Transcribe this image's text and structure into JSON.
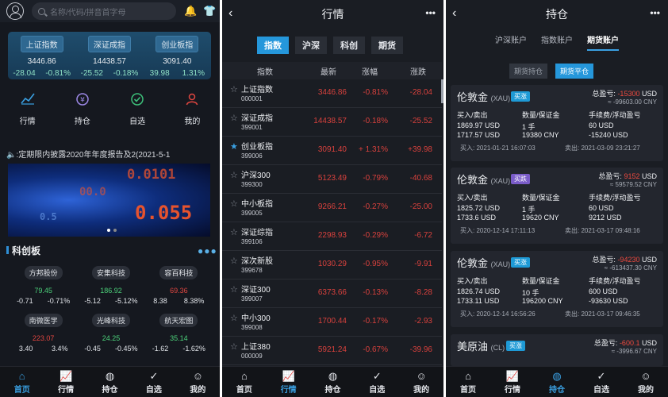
{
  "p1": {
    "search_placeholder": "名称/代码/拼音首字母",
    "indices": [
      {
        "name": "上证指数",
        "value": "3446.86",
        "chg": "-28.04",
        "pct": "-0.81%"
      },
      {
        "name": "深证成指",
        "value": "14438.57",
        "chg": "-25.52",
        "pct": "-0.18%"
      },
      {
        "name": "创业板指",
        "value": "3091.40",
        "chg": "39.98",
        "pct": "1.31%"
      }
    ],
    "grid": [
      {
        "label": "行情",
        "icon": "chart-icon"
      },
      {
        "label": "持仓",
        "icon": "wallet-icon"
      },
      {
        "label": "自选",
        "icon": "check-icon"
      },
      {
        "label": "我的",
        "icon": "user-icon"
      }
    ],
    "marquee": ":定期限内披露2020年年度报告及2(2021-5-1",
    "banner_texts": [
      "0.0101",
      "0.055",
      "00.0",
      "0.5"
    ],
    "section_title": "科创板",
    "stocks": [
      {
        "name": "方邦股份",
        "price": "79.45",
        "chg": "-0.71",
        "pct": "-0.71%",
        "color": "#4cd17a"
      },
      {
        "name": "安集科技",
        "price": "186.92",
        "chg": "-5.12",
        "pct": "-5.12%",
        "color": "#4cd17a"
      },
      {
        "name": "容百科技",
        "price": "69.36",
        "chg": "8.38",
        "pct": "8.38%",
        "color": "#e04640"
      },
      {
        "name": "南微医学",
        "price": "223.07",
        "chg": "3.40",
        "pct": "3.4%",
        "color": "#e04640"
      },
      {
        "name": "光峰科技",
        "price": "24.25",
        "chg": "-0.45",
        "pct": "-0.45%",
        "color": "#4cd17a"
      },
      {
        "name": "航天宏图",
        "price": "35.14",
        "chg": "-1.62",
        "pct": "-1.62%",
        "color": "#4cd17a"
      }
    ]
  },
  "tabs": [
    "首页",
    "行情",
    "持仓",
    "自选",
    "我的"
  ],
  "p2": {
    "title": "行情",
    "segs": [
      "指数",
      "沪深",
      "科创",
      "期货"
    ],
    "head": [
      "指数",
      "最新",
      "涨幅",
      "涨跌"
    ],
    "rows": [
      {
        "name": "上证指数",
        "code": "000001",
        "last": "3446.86",
        "pct": "-0.81%",
        "chg": "-28.04",
        "fav": false
      },
      {
        "name": "深证成指",
        "code": "399001",
        "last": "14438.57",
        "pct": "-0.18%",
        "chg": "-25.52",
        "fav": false
      },
      {
        "name": "创业板指",
        "code": "399006",
        "last": "3091.40",
        "pct": "+ 1.31%",
        "chg": "+39.98",
        "fav": true
      },
      {
        "name": "沪深300",
        "code": "399300",
        "last": "5123.49",
        "pct": "-0.79%",
        "chg": "-40.68",
        "fav": false
      },
      {
        "name": "中小板指",
        "code": "399005",
        "last": "9266.21",
        "pct": "-0.27%",
        "chg": "-25.00",
        "fav": false
      },
      {
        "name": "深证综指",
        "code": "399106",
        "last": "2298.93",
        "pct": "-0.29%",
        "chg": "-6.72",
        "fav": false
      },
      {
        "name": "深次新股",
        "code": "399678",
        "last": "1030.29",
        "pct": "-0.95%",
        "chg": "-9.91",
        "fav": false
      },
      {
        "name": "深证300",
        "code": "399007",
        "last": "6373.66",
        "pct": "-0.13%",
        "chg": "-8.28",
        "fav": false
      },
      {
        "name": "中小300",
        "code": "399008",
        "last": "1700.44",
        "pct": "-0.17%",
        "chg": "-2.93",
        "fav": false
      },
      {
        "name": "上证380",
        "code": "000009",
        "last": "5921.24",
        "pct": "-0.67%",
        "chg": "-39.96",
        "fav": false
      }
    ]
  },
  "p3": {
    "title": "持仓",
    "sub_tabs": [
      "沪深账户",
      "指数账户",
      "期货账户"
    ],
    "modes": [
      "期货持仓",
      "期货平仓"
    ],
    "labels": {
      "buy_sell": "买入/卖出",
      "qty": "数量/保证金",
      "fee": "手续费/浮动盈亏",
      "total": "总盈亏:",
      "buy_time": "买入:",
      "sell_time": "卖出:"
    },
    "cards": [
      {
        "name": "伦敦金",
        "code": "(XAU)",
        "dir": "买涨",
        "dir_color": "#1e9ad6",
        "pl": "-15300",
        "unit": "USD",
        "cny": "≈ -99603.00 CNY",
        "buy": "1869.97 USD",
        "sell": "1717.57 USD",
        "qty": "1 手",
        "margin": "19380 CNY",
        "fee": "60 USD",
        "float": "-15240 USD",
        "buy_t": "2021-01-21 16:07:03",
        "sell_t": "2021-03-09 23:21:27"
      },
      {
        "name": "伦敦金",
        "code": "(XAU)",
        "dir": "买跌",
        "dir_color": "#7a5cc8",
        "pl": "9152",
        "unit": "USD",
        "cny": "≈ 59579.52 CNY",
        "buy": "1825.72 USD",
        "sell": "1733.6 USD",
        "qty": "1 手",
        "margin": "19620 CNY",
        "fee": "60 USD",
        "float": "9212 USD",
        "buy_t": "2020-12-14 17:11:13",
        "sell_t": "2021-03-17 09:48:16"
      },
      {
        "name": "伦敦金",
        "code": "(XAU)",
        "dir": "买涨",
        "dir_color": "#1e9ad6",
        "pl": "-94230",
        "unit": "USD",
        "cny": "≈ -613437.30 CNY",
        "buy": "1826.74 USD",
        "sell": "1733.11 USD",
        "qty": "10 手",
        "margin": "196200 CNY",
        "fee": "600 USD",
        "float": "-93630 USD",
        "buy_t": "2020-12-14 16:56:26",
        "sell_t": "2021-03-17 09:46:35"
      },
      {
        "name": "美原油",
        "code": "(CL)",
        "dir": "买涨",
        "dir_color": "#1e9ad6",
        "pl": "-600.1",
        "unit": "USD",
        "cny": "≈ -3996.67 CNY",
        "buy": "",
        "sell": "",
        "qty": "",
        "margin": "",
        "fee": "",
        "float": "",
        "buy_t": "",
        "sell_t": ""
      }
    ]
  }
}
